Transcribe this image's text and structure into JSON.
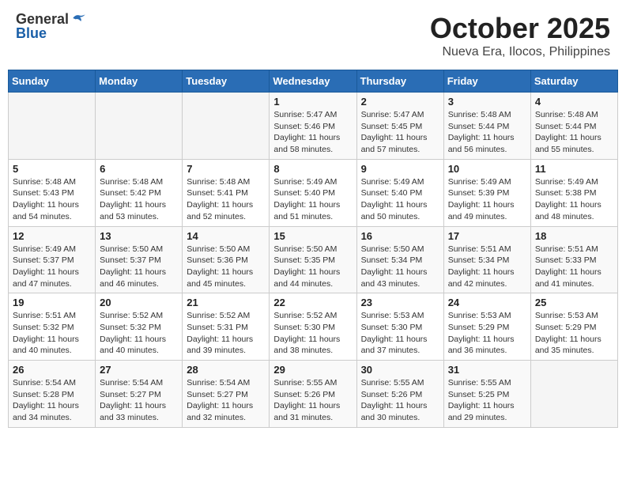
{
  "header": {
    "logo_general": "General",
    "logo_blue": "Blue",
    "month": "October 2025",
    "location": "Nueva Era, Ilocos, Philippines"
  },
  "weekdays": [
    "Sunday",
    "Monday",
    "Tuesday",
    "Wednesday",
    "Thursday",
    "Friday",
    "Saturday"
  ],
  "weeks": [
    [
      {
        "day": "",
        "info": ""
      },
      {
        "day": "",
        "info": ""
      },
      {
        "day": "",
        "info": ""
      },
      {
        "day": "1",
        "info": "Sunrise: 5:47 AM\nSunset: 5:46 PM\nDaylight: 11 hours\nand 58 minutes."
      },
      {
        "day": "2",
        "info": "Sunrise: 5:47 AM\nSunset: 5:45 PM\nDaylight: 11 hours\nand 57 minutes."
      },
      {
        "day": "3",
        "info": "Sunrise: 5:48 AM\nSunset: 5:44 PM\nDaylight: 11 hours\nand 56 minutes."
      },
      {
        "day": "4",
        "info": "Sunrise: 5:48 AM\nSunset: 5:44 PM\nDaylight: 11 hours\nand 55 minutes."
      }
    ],
    [
      {
        "day": "5",
        "info": "Sunrise: 5:48 AM\nSunset: 5:43 PM\nDaylight: 11 hours\nand 54 minutes."
      },
      {
        "day": "6",
        "info": "Sunrise: 5:48 AM\nSunset: 5:42 PM\nDaylight: 11 hours\nand 53 minutes."
      },
      {
        "day": "7",
        "info": "Sunrise: 5:48 AM\nSunset: 5:41 PM\nDaylight: 11 hours\nand 52 minutes."
      },
      {
        "day": "8",
        "info": "Sunrise: 5:49 AM\nSunset: 5:40 PM\nDaylight: 11 hours\nand 51 minutes."
      },
      {
        "day": "9",
        "info": "Sunrise: 5:49 AM\nSunset: 5:40 PM\nDaylight: 11 hours\nand 50 minutes."
      },
      {
        "day": "10",
        "info": "Sunrise: 5:49 AM\nSunset: 5:39 PM\nDaylight: 11 hours\nand 49 minutes."
      },
      {
        "day": "11",
        "info": "Sunrise: 5:49 AM\nSunset: 5:38 PM\nDaylight: 11 hours\nand 48 minutes."
      }
    ],
    [
      {
        "day": "12",
        "info": "Sunrise: 5:49 AM\nSunset: 5:37 PM\nDaylight: 11 hours\nand 47 minutes."
      },
      {
        "day": "13",
        "info": "Sunrise: 5:50 AM\nSunset: 5:37 PM\nDaylight: 11 hours\nand 46 minutes."
      },
      {
        "day": "14",
        "info": "Sunrise: 5:50 AM\nSunset: 5:36 PM\nDaylight: 11 hours\nand 45 minutes."
      },
      {
        "day": "15",
        "info": "Sunrise: 5:50 AM\nSunset: 5:35 PM\nDaylight: 11 hours\nand 44 minutes."
      },
      {
        "day": "16",
        "info": "Sunrise: 5:50 AM\nSunset: 5:34 PM\nDaylight: 11 hours\nand 43 minutes."
      },
      {
        "day": "17",
        "info": "Sunrise: 5:51 AM\nSunset: 5:34 PM\nDaylight: 11 hours\nand 42 minutes."
      },
      {
        "day": "18",
        "info": "Sunrise: 5:51 AM\nSunset: 5:33 PM\nDaylight: 11 hours\nand 41 minutes."
      }
    ],
    [
      {
        "day": "19",
        "info": "Sunrise: 5:51 AM\nSunset: 5:32 PM\nDaylight: 11 hours\nand 40 minutes."
      },
      {
        "day": "20",
        "info": "Sunrise: 5:52 AM\nSunset: 5:32 PM\nDaylight: 11 hours\nand 40 minutes."
      },
      {
        "day": "21",
        "info": "Sunrise: 5:52 AM\nSunset: 5:31 PM\nDaylight: 11 hours\nand 39 minutes."
      },
      {
        "day": "22",
        "info": "Sunrise: 5:52 AM\nSunset: 5:30 PM\nDaylight: 11 hours\nand 38 minutes."
      },
      {
        "day": "23",
        "info": "Sunrise: 5:53 AM\nSunset: 5:30 PM\nDaylight: 11 hours\nand 37 minutes."
      },
      {
        "day": "24",
        "info": "Sunrise: 5:53 AM\nSunset: 5:29 PM\nDaylight: 11 hours\nand 36 minutes."
      },
      {
        "day": "25",
        "info": "Sunrise: 5:53 AM\nSunset: 5:29 PM\nDaylight: 11 hours\nand 35 minutes."
      }
    ],
    [
      {
        "day": "26",
        "info": "Sunrise: 5:54 AM\nSunset: 5:28 PM\nDaylight: 11 hours\nand 34 minutes."
      },
      {
        "day": "27",
        "info": "Sunrise: 5:54 AM\nSunset: 5:27 PM\nDaylight: 11 hours\nand 33 minutes."
      },
      {
        "day": "28",
        "info": "Sunrise: 5:54 AM\nSunset: 5:27 PM\nDaylight: 11 hours\nand 32 minutes."
      },
      {
        "day": "29",
        "info": "Sunrise: 5:55 AM\nSunset: 5:26 PM\nDaylight: 11 hours\nand 31 minutes."
      },
      {
        "day": "30",
        "info": "Sunrise: 5:55 AM\nSunset: 5:26 PM\nDaylight: 11 hours\nand 30 minutes."
      },
      {
        "day": "31",
        "info": "Sunrise: 5:55 AM\nSunset: 5:25 PM\nDaylight: 11 hours\nand 29 minutes."
      },
      {
        "day": "",
        "info": ""
      }
    ]
  ]
}
